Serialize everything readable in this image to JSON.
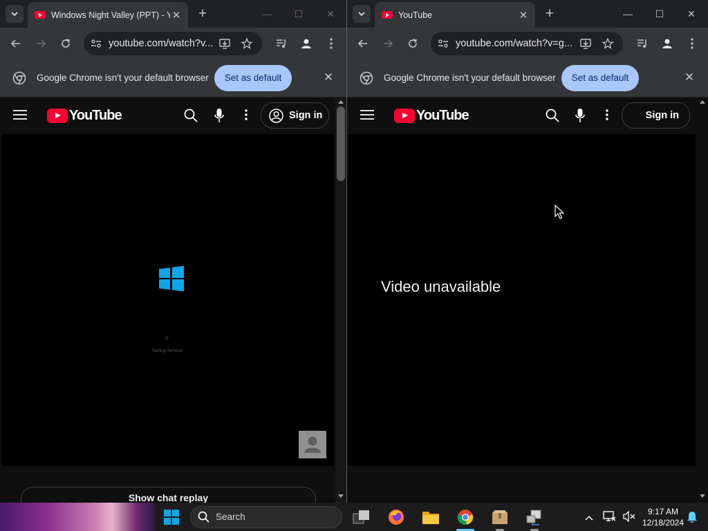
{
  "left_window": {
    "tab_title": "Windows Night Valley (PPT) - Y",
    "url": "youtube.com/watch?v...",
    "infobar_message": "Google Chrome isn't your default browser",
    "infobar_button": "Set as default",
    "brand": "YouTube",
    "sign_in": "Sign in",
    "player_status_text": "Starting Services",
    "chat_button": "Show chat replay"
  },
  "right_window": {
    "tab_title": "YouTube",
    "url": "youtube.com/watch?v=g...",
    "infobar_message": "Google Chrome isn't your default browser",
    "infobar_button": "Set as default",
    "brand": "YouTube",
    "sign_in": "Sign in",
    "player_message": "Video unavailable"
  },
  "taskbar": {
    "search_placeholder": "Search",
    "time": "9:17 AM",
    "date": "12/18/2024"
  },
  "colors": {
    "youtube_red": "#ff0033",
    "infobar_button_bg": "#a8c7fa",
    "windows_blue": "#0ea5e9",
    "active_app_indicator": "#60cdff"
  }
}
